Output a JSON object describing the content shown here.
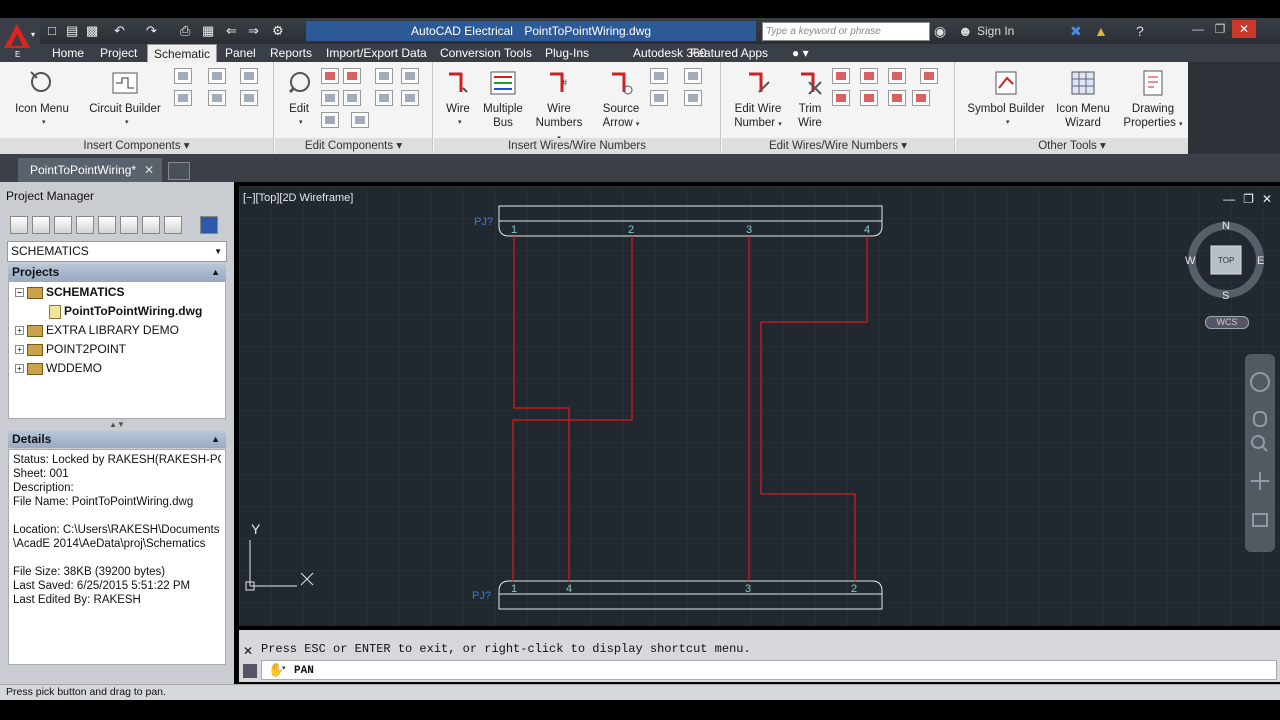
{
  "app": {
    "product": "AutoCAD Electrical",
    "document": "PointToPointWiring.dwg",
    "search_placeholder": "Type a keyword or phrase",
    "sign_in": "Sign In"
  },
  "ribbon_tabs": [
    "Home",
    "Project",
    "Schematic",
    "Panel",
    "Reports",
    "Import/Export Data",
    "Conversion Tools",
    "Plug-Ins",
    "Autodesk 360",
    "Featured Apps"
  ],
  "active_tab": "Schematic",
  "panels": {
    "insert_components": {
      "title": "Insert Components",
      "icon_menu": "Icon Menu",
      "circuit_builder": "Circuit Builder"
    },
    "edit_components": {
      "title": "Edit Components",
      "edit": "Edit"
    },
    "insert_wires": {
      "title": "Insert Wires/Wire Numbers",
      "wire": "Wire",
      "multiple_bus_1": "Multiple",
      "multiple_bus_2": "Bus",
      "wire_numbers_1": "Wire",
      "wire_numbers_2": "Numbers",
      "source_arrow_1": "Source",
      "source_arrow_2": "Arrow"
    },
    "edit_wires": {
      "title": "Edit Wires/Wire Numbers",
      "edit_wire_number_1": "Edit Wire",
      "edit_wire_number_2": "Number",
      "trim_wire_1": "Trim",
      "trim_wire_2": "Wire"
    },
    "other_tools": {
      "title": "Other Tools",
      "symbol_builder": "Symbol Builder",
      "icon_menu_wizard_1": "Icon Menu",
      "icon_menu_wizard_2": "Wizard",
      "drawing_properties_1": "Drawing",
      "drawing_properties_2": "Properties"
    }
  },
  "doc_tab": {
    "label": "PointToPointWiring*"
  },
  "project_manager": {
    "title": "Project Manager",
    "selector": "SCHEMATICS",
    "projects_header": "Projects",
    "tree": [
      {
        "label": "SCHEMATICS",
        "bold": true
      },
      {
        "label": "PointToPointWiring.dwg",
        "bold": true
      },
      {
        "label": "EXTRA LIBRARY DEMO"
      },
      {
        "label": "POINT2POINT"
      },
      {
        "label": "WDDEMO"
      }
    ],
    "details_header": "Details",
    "details": [
      "Status: Locked by RAKESH(RAKESH-PC)",
      "Sheet: 001",
      "Description:",
      "File Name: PointToPointWiring.dwg",
      "",
      "Location: C:\\Users\\RAKESH\\Documents",
      "\\AcadE 2014\\AeData\\proj\\Schematics",
      "",
      "File Size: 38KB (39200 bytes)",
      "Last Saved: 6/25/2015 5:51:22 PM",
      "Last Edited By: RAKESH"
    ]
  },
  "viewport": {
    "label": "[−][Top][2D Wireframe]",
    "viewcube": {
      "top": "TOP",
      "n": "N",
      "s": "S",
      "e": "E",
      "w": "W"
    },
    "wcs": "WCS",
    "ucs_x": "X",
    "ucs_y": "Y",
    "top_connector": {
      "tag": "PJ?",
      "pins": [
        "1",
        "2",
        "3",
        "4"
      ]
    },
    "bottom_connector": {
      "tag": "PJ?",
      "pins": [
        "1",
        "4",
        "3",
        "2"
      ]
    },
    "wire_color": "#e01818",
    "pin_label_color": "#88c8c8",
    "tag_color": "#3a7adf"
  },
  "command_line": {
    "history": "Press ESC or ENTER to exit, or right-click to display shortcut menu.",
    "current": "PAN"
  },
  "status_bar": {
    "text": "Press pick button and drag to pan."
  }
}
